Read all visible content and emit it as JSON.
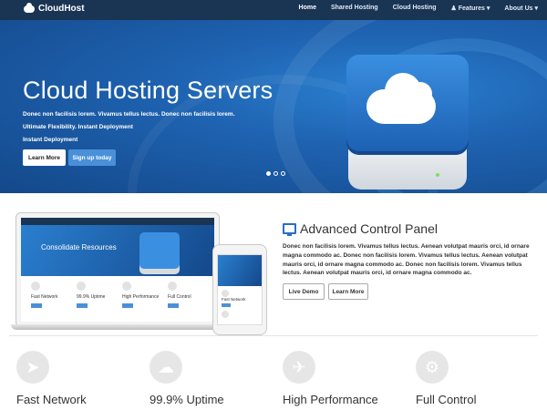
{
  "nav": {
    "brand": "CloudHost",
    "links": [
      "Home",
      "Shared Hosting",
      "Cloud Hosting",
      "Features",
      "About Us"
    ]
  },
  "hero": {
    "title": "Cloud Hosting Servers",
    "line1": "Donec non facilisis lorem. Vivamus tellus lectus. Donec non facilisis lorem.",
    "line2": "Ultimate Flexibility. Instant Deployment",
    "line3": "Instant Deployment",
    "learn_more": "Learn More",
    "sign_up": "Sign up today"
  },
  "mockup": {
    "laptop_brand": "CloudHost",
    "laptop_title": "Consolidate Resources",
    "features": [
      "Fast Network",
      "99.9% Uptime",
      "High Performance",
      "Full Control"
    ],
    "phone_feature": "Fast Network"
  },
  "panel": {
    "title": "Advanced Control Panel",
    "text": "Donec non facilisis lorem. Vivamus tellus lectus. Aenean volutpat mauris orci, id ornare magna commodo ac. Donec non facilisis lorem. Vivamus tellus lectus. Aenean volutpat mauris orci, id ornare magna commodo ac. Donec non facilisis lorem. Vivamus tellus lectus. Aenean volutpat mauris orci, id ornare magna commodo ac.",
    "live_demo": "Live Demo",
    "learn_more": "Learn More"
  },
  "features": [
    {
      "label": "Fast Network",
      "icon": "rocket-icon"
    },
    {
      "label": "99.9% Uptime",
      "icon": "cloud-upload-icon"
    },
    {
      "label": "High Performance",
      "icon": "plane-icon"
    },
    {
      "label": "Full Control",
      "icon": "gear-icon"
    }
  ],
  "colors": {
    "nav": "#1a3554",
    "accent": "#4a90d9",
    "icon_circle": "#e6e6e6"
  }
}
